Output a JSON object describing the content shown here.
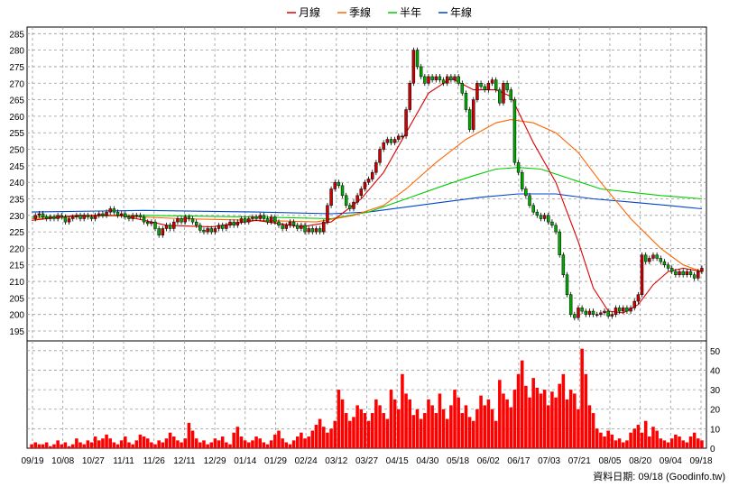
{
  "chart_data": {
    "type": "candlestick",
    "colors": {
      "up": "#cc0000",
      "down": "#00aa00",
      "volume": "#ff0000",
      "month": "#dd0000",
      "season": "#ff6600",
      "half": "#00cc00",
      "year": "#0044cc",
      "grid": "#999999"
    },
    "legend": [
      {
        "label": "月線",
        "color": "#dd0000"
      },
      {
        "label": "季線",
        "color": "#ff6600"
      },
      {
        "label": "半年",
        "color": "#00cc00"
      },
      {
        "label": "年線",
        "color": "#0044cc"
      }
    ],
    "x_ticks": [
      "09/19",
      "10/08",
      "10/27",
      "11/11",
      "11/26",
      "12/11",
      "12/29",
      "01/14",
      "01/29",
      "02/24",
      "03/12",
      "03/27",
      "04/15",
      "04/30",
      "05/18",
      "06/02",
      "06/17",
      "07/03",
      "07/21",
      "08/05",
      "08/20",
      "09/04",
      "09/18"
    ],
    "price_ticks": [
      195,
      200,
      205,
      210,
      215,
      220,
      225,
      230,
      235,
      240,
      245,
      250,
      255,
      260,
      265,
      270,
      275,
      280,
      285
    ],
    "price_range": [
      192,
      287
    ],
    "volume_ticks": [
      0,
      10,
      20,
      30,
      40,
      50
    ],
    "volume_range": [
      0,
      55
    ],
    "price_path": [
      [
        0,
        229
      ],
      [
        1,
        230
      ],
      [
        2,
        230.5
      ],
      [
        3,
        229.5
      ],
      [
        4,
        229
      ],
      [
        5,
        229.5
      ],
      [
        6,
        229
      ],
      [
        7,
        230
      ],
      [
        8,
        229.5
      ],
      [
        9,
        228
      ],
      [
        10,
        229
      ],
      [
        11,
        229.5
      ],
      [
        12,
        230
      ],
      [
        13,
        229
      ],
      [
        14,
        230
      ],
      [
        15,
        229.5
      ],
      [
        16,
        229
      ],
      [
        17,
        230
      ],
      [
        18,
        230.5
      ],
      [
        19,
        230
      ],
      [
        20,
        231
      ],
      [
        21,
        232
      ],
      [
        22,
        231
      ],
      [
        23,
        230
      ],
      [
        24,
        230.5
      ],
      [
        25,
        229.5
      ],
      [
        26,
        229
      ],
      [
        27,
        230
      ],
      [
        28,
        230
      ],
      [
        29,
        229.5
      ],
      [
        30,
        228
      ],
      [
        31,
        227.5
      ],
      [
        32,
        228
      ],
      [
        33,
        226
      ],
      [
        34,
        224
      ],
      [
        35,
        226
      ],
      [
        36,
        227
      ],
      [
        37,
        226
      ],
      [
        38,
        228
      ],
      [
        39,
        229
      ],
      [
        40,
        228
      ],
      [
        41,
        229.5
      ],
      [
        42,
        229
      ],
      [
        43,
        228
      ],
      [
        44,
        227
      ],
      [
        45,
        225.5
      ],
      [
        46,
        225
      ],
      [
        47,
        226
      ],
      [
        48,
        225
      ],
      [
        49,
        226
      ],
      [
        50,
        227
      ],
      [
        51,
        226
      ],
      [
        52,
        227
      ],
      [
        53,
        228
      ],
      [
        54,
        227
      ],
      [
        55,
        228
      ],
      [
        56,
        229
      ],
      [
        57,
        228
      ],
      [
        58,
        229
      ],
      [
        59,
        229.5
      ],
      [
        60,
        229
      ],
      [
        61,
        230
      ],
      [
        62,
        229
      ],
      [
        63,
        228
      ],
      [
        64,
        229.5
      ],
      [
        65,
        228
      ],
      [
        66,
        227
      ],
      [
        67,
        226
      ],
      [
        68,
        227
      ],
      [
        69,
        228
      ],
      [
        70,
        227
      ],
      [
        71,
        226
      ],
      [
        72,
        227
      ],
      [
        73,
        225
      ],
      [
        74,
        226
      ],
      [
        75,
        225
      ],
      [
        76,
        226
      ],
      [
        77,
        225
      ],
      [
        78,
        228
      ],
      [
        79,
        233
      ],
      [
        80,
        238
      ],
      [
        81,
        240
      ],
      [
        82,
        239
      ],
      [
        83,
        236
      ],
      [
        84,
        233
      ],
      [
        85,
        232
      ],
      [
        86,
        234
      ],
      [
        87,
        236
      ],
      [
        88,
        238
      ],
      [
        89,
        240
      ],
      [
        90,
        241
      ],
      [
        91,
        243
      ],
      [
        92,
        246
      ],
      [
        93,
        250
      ],
      [
        94,
        252
      ],
      [
        95,
        253
      ],
      [
        96,
        252
      ],
      [
        97,
        253
      ],
      [
        98,
        254
      ],
      [
        99,
        254
      ],
      [
        100,
        262
      ],
      [
        101,
        270
      ],
      [
        102,
        280
      ],
      [
        103,
        275
      ],
      [
        104,
        272
      ],
      [
        105,
        270
      ],
      [
        106,
        272
      ],
      [
        107,
        271
      ],
      [
        108,
        272
      ],
      [
        109,
        271
      ],
      [
        110,
        270
      ],
      [
        111,
        272
      ],
      [
        112,
        271
      ],
      [
        113,
        272
      ],
      [
        114,
        270
      ],
      [
        115,
        267
      ],
      [
        116,
        262
      ],
      [
        117,
        256
      ],
      [
        118,
        265
      ],
      [
        119,
        270
      ],
      [
        120,
        269
      ],
      [
        121,
        268
      ],
      [
        122,
        270
      ],
      [
        123,
        271
      ],
      [
        124,
        268
      ],
      [
        125,
        264
      ],
      [
        126,
        270
      ],
      [
        127,
        268
      ],
      [
        128,
        265
      ],
      [
        129,
        246
      ],
      [
        130,
        243
      ],
      [
        131,
        238
      ],
      [
        132,
        236
      ],
      [
        133,
        233
      ],
      [
        134,
        231
      ],
      [
        135,
        230
      ],
      [
        136,
        229
      ],
      [
        137,
        230
      ],
      [
        138,
        228
      ],
      [
        139,
        227
      ],
      [
        140,
        225
      ],
      [
        141,
        218
      ],
      [
        142,
        212
      ],
      [
        143,
        206
      ],
      [
        144,
        200
      ],
      [
        145,
        199
      ],
      [
        146,
        202
      ],
      [
        147,
        201
      ],
      [
        148,
        200
      ],
      [
        149,
        201
      ],
      [
        150,
        200
      ],
      [
        151,
        200
      ],
      [
        152,
        200.5
      ],
      [
        153,
        201
      ],
      [
        154,
        199.5
      ],
      [
        155,
        200
      ],
      [
        156,
        202
      ],
      [
        157,
        201
      ],
      [
        158,
        202
      ],
      [
        159,
        201
      ],
      [
        160,
        202
      ],
      [
        161,
        204
      ],
      [
        162,
        206
      ],
      [
        163,
        218
      ],
      [
        164,
        216
      ],
      [
        165,
        217
      ],
      [
        166,
        218
      ],
      [
        167,
        217
      ],
      [
        168,
        216
      ],
      [
        169,
        215
      ],
      [
        170,
        214
      ],
      [
        171,
        213
      ],
      [
        172,
        212
      ],
      [
        173,
        213
      ],
      [
        174,
        212
      ],
      [
        175,
        213
      ],
      [
        176,
        212
      ],
      [
        177,
        211
      ],
      [
        178,
        213
      ],
      [
        179,
        214
      ]
    ],
    "month_line": [
      [
        0,
        228.5
      ],
      [
        12,
        230
      ],
      [
        24,
        230
      ],
      [
        36,
        227
      ],
      [
        48,
        226.5
      ],
      [
        60,
        228.5
      ],
      [
        72,
        226.5
      ],
      [
        80,
        228
      ],
      [
        88,
        235
      ],
      [
        94,
        243
      ],
      [
        100,
        255
      ],
      [
        106,
        267
      ],
      [
        112,
        271.5
      ],
      [
        118,
        268
      ],
      [
        124,
        268
      ],
      [
        128,
        266
      ],
      [
        134,
        252
      ],
      [
        140,
        240
      ],
      [
        146,
        222
      ],
      [
        150,
        208
      ],
      [
        154,
        201
      ],
      [
        158,
        200.5
      ],
      [
        162,
        203
      ],
      [
        166,
        209
      ],
      [
        170,
        213
      ],
      [
        174,
        214
      ],
      [
        179,
        213
      ]
    ],
    "season_line": [
      [
        0,
        229
      ],
      [
        20,
        230
      ],
      [
        40,
        229
      ],
      [
        60,
        228.5
      ],
      [
        76,
        228
      ],
      [
        86,
        230
      ],
      [
        94,
        233
      ],
      [
        100,
        238
      ],
      [
        108,
        246
      ],
      [
        116,
        253
      ],
      [
        124,
        258
      ],
      [
        128,
        259
      ],
      [
        134,
        258
      ],
      [
        140,
        255
      ],
      [
        146,
        249
      ],
      [
        152,
        240
      ],
      [
        160,
        229
      ],
      [
        168,
        220
      ],
      [
        174,
        215
      ],
      [
        179,
        213
      ]
    ],
    "half_line": [
      [
        0,
        229.5
      ],
      [
        30,
        230
      ],
      [
        60,
        229.5
      ],
      [
        80,
        229
      ],
      [
        90,
        231
      ],
      [
        100,
        235
      ],
      [
        110,
        239
      ],
      [
        118,
        242
      ],
      [
        124,
        244
      ],
      [
        130,
        244.5
      ],
      [
        136,
        244
      ],
      [
        144,
        241
      ],
      [
        152,
        238
      ],
      [
        160,
        237
      ],
      [
        168,
        236
      ],
      [
        174,
        235.5
      ],
      [
        179,
        235
      ]
    ],
    "year_line": [
      [
        0,
        231
      ],
      [
        30,
        231.5
      ],
      [
        60,
        231
      ],
      [
        80,
        230.5
      ],
      [
        90,
        231
      ],
      [
        100,
        232.5
      ],
      [
        110,
        234
      ],
      [
        120,
        235.5
      ],
      [
        130,
        236.5
      ],
      [
        140,
        236.5
      ],
      [
        150,
        235
      ],
      [
        160,
        234
      ],
      [
        170,
        233
      ],
      [
        179,
        232
      ]
    ],
    "volume_bars": [
      2,
      3,
      2,
      2,
      3,
      1,
      2,
      4,
      2,
      3,
      1,
      2,
      5,
      3,
      2,
      4,
      3,
      6,
      4,
      5,
      7,
      5,
      3,
      2,
      4,
      6,
      3,
      2,
      4,
      7,
      6,
      5,
      3,
      2,
      4,
      3,
      5,
      8,
      6,
      4,
      3,
      5,
      13,
      9,
      5,
      3,
      4,
      2,
      3,
      5,
      4,
      6,
      3,
      2,
      8,
      11,
      6,
      4,
      3,
      4,
      6,
      5,
      3,
      2,
      4,
      7,
      9,
      5,
      3,
      2,
      4,
      6,
      8,
      5,
      6,
      9,
      12,
      15,
      11,
      8,
      10,
      14,
      30,
      25,
      18,
      14,
      16,
      22,
      20,
      18,
      14,
      18,
      25,
      22,
      18,
      15,
      30,
      25,
      20,
      38,
      28,
      25,
      17,
      20,
      15,
      18,
      25,
      22,
      18,
      28,
      20,
      15,
      22,
      30,
      26,
      18,
      22,
      16,
      14,
      20,
      27,
      22,
      25,
      20,
      14,
      35,
      28,
      25,
      21,
      30,
      38,
      45,
      32,
      26,
      36,
      31,
      28,
      30,
      22,
      29,
      26,
      33,
      38,
      25,
      30,
      28,
      20,
      51,
      38,
      22,
      18,
      10,
      8,
      6,
      9,
      7,
      4,
      5,
      3,
      4,
      8,
      10,
      12,
      8,
      14,
      6,
      11,
      9,
      5,
      4,
      3,
      5,
      7,
      6,
      4,
      3,
      6,
      8,
      5,
      4
    ]
  },
  "footer": {
    "source_text": "資料日期: 09/18  (Goodinfo.tw)"
  }
}
